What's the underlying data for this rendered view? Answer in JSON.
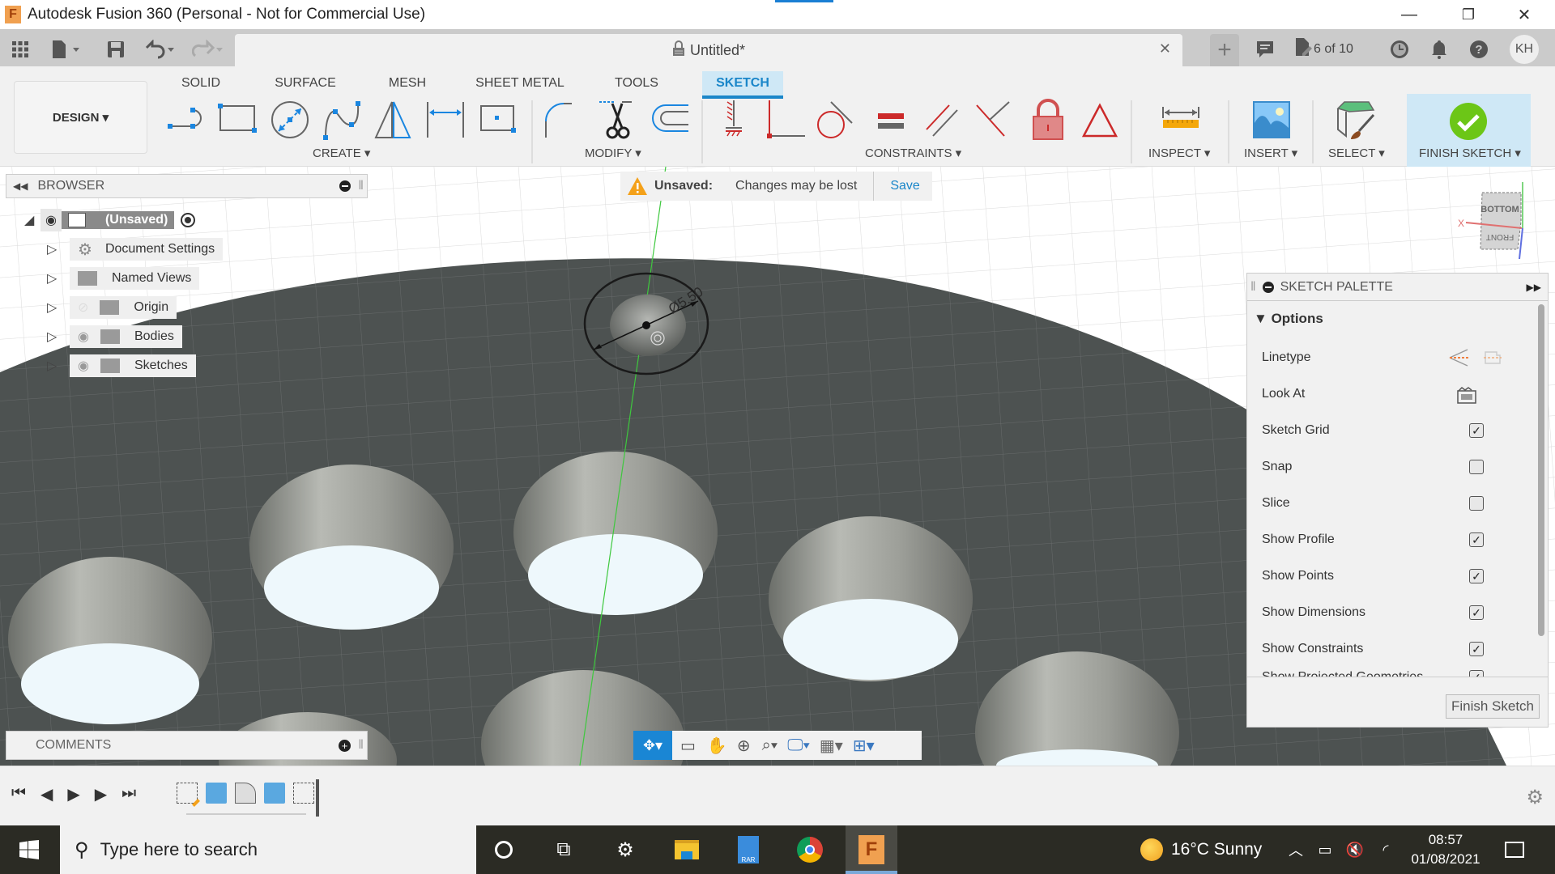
{
  "window": {
    "title": "Autodesk Fusion 360 (Personal - Not for Commercial Use)",
    "minimize": "—",
    "restore": "❐",
    "close": "✕"
  },
  "appbar": {
    "document_title": "Untitled*",
    "close_tab": "✕",
    "new_tab": "+",
    "version_label": "6 of 10",
    "user_initials": "KH"
  },
  "ribbon": {
    "workspace": "DESIGN ▾",
    "tabs": [
      {
        "label": "SOLID",
        "active": false
      },
      {
        "label": "SURFACE",
        "active": false
      },
      {
        "label": "MESH",
        "active": false
      },
      {
        "label": "SHEET METAL",
        "active": false
      },
      {
        "label": "TOOLS",
        "active": false
      },
      {
        "label": "SKETCH",
        "active": true
      }
    ],
    "groups": {
      "create": "CREATE ▾",
      "modify": "MODIFY ▾",
      "constraints": "CONSTRAINTS ▾",
      "inspect": "INSPECT ▾",
      "insert": "INSERT ▾",
      "select": "SELECT ▾",
      "finish": "FINISH SKETCH ▾"
    }
  },
  "browser": {
    "title": "BROWSER",
    "root": "(Unsaved)",
    "items": [
      {
        "label": "Document Settings",
        "icon": "gear-icon"
      },
      {
        "label": "Named Views",
        "icon": "folder-icon"
      },
      {
        "label": "Origin",
        "icon": "folder-icon",
        "visible": false
      },
      {
        "label": "Bodies",
        "icon": "folder-icon",
        "visible": true
      },
      {
        "label": "Sketches",
        "icon": "folder-icon",
        "visible": true
      }
    ]
  },
  "unsaved_banner": {
    "label": "Unsaved:",
    "message": "Changes may be lost",
    "save": "Save"
  },
  "viewcube": {
    "top_face": "BOTTOM",
    "front_face": "FRONT",
    "x_axis": "X"
  },
  "sketch": {
    "dimension": "Ø5.50"
  },
  "palette": {
    "title": "SKETCH PALETTE",
    "section": "Options",
    "rows": [
      {
        "label": "Linetype",
        "type": "icons"
      },
      {
        "label": "Look At",
        "type": "icon"
      },
      {
        "label": "Sketch Grid",
        "type": "checkbox",
        "checked": true
      },
      {
        "label": "Snap",
        "type": "checkbox",
        "checked": false
      },
      {
        "label": "Slice",
        "type": "checkbox",
        "checked": false
      },
      {
        "label": "Show Profile",
        "type": "checkbox",
        "checked": true
      },
      {
        "label": "Show Points",
        "type": "checkbox",
        "checked": true
      },
      {
        "label": "Show Dimensions",
        "type": "checkbox",
        "checked": true
      },
      {
        "label": "Show Constraints",
        "type": "checkbox",
        "checked": true
      },
      {
        "label": "Show Projected Geometries",
        "type": "checkbox",
        "checked": true
      }
    ],
    "finish_button": "Finish Sketch"
  },
  "comments": {
    "title": "COMMENTS"
  },
  "taskbar": {
    "search_placeholder": "Type here to search",
    "weather": "16°C  Sunny",
    "time": "08:57",
    "date": "01/08/2021"
  }
}
